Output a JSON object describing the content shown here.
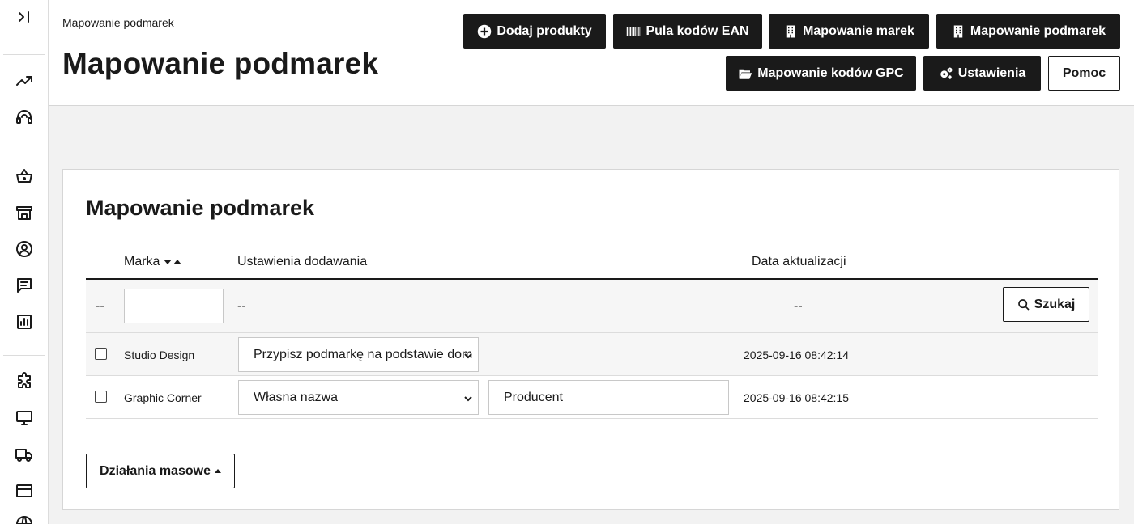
{
  "header": {
    "breadcrumb": "Mapowanie podmarek",
    "title": "Mapowanie podmarek"
  },
  "toolbar": {
    "add_products": "Dodaj produkty",
    "ean_pool": "Pula kodów EAN",
    "brand_mapping": "Mapowanie marek",
    "subbrand_mapping": "Mapowanie podmarek",
    "gpc_mapping": "Mapowanie kodów GPC",
    "settings": "Ustawienia",
    "help": "Pomoc"
  },
  "sidebar": {
    "icons": [
      "expand-sidebar-icon",
      "trending-icon",
      "headset-icon",
      "basket-icon",
      "store-icon",
      "user-icon",
      "chat-icon",
      "chart-icon",
      "puzzle-icon",
      "monitor-icon",
      "truck-icon",
      "credit-card-icon",
      "globe-icon"
    ]
  },
  "card": {
    "title": "Mapowanie podmarek",
    "columns": {
      "brand": "Marka",
      "add_settings": "Ustawienia dodawania",
      "updated": "Data aktualizacji"
    },
    "filters": {
      "checkbox_placeholder": "--",
      "brand_value": "",
      "add_settings_placeholder": "--",
      "updated_placeholder": "--",
      "search_label": "Szukaj"
    },
    "rows": [
      {
        "brand": "Studio Design",
        "setting": "Przypisz podmarkę na podstawie dom",
        "custom_name": "",
        "updated": "2025-09-16 08:42:14"
      },
      {
        "brand": "Graphic Corner",
        "setting": "Własna nazwa",
        "custom_name": "Producent",
        "updated": "2025-09-16 08:42:15"
      }
    ],
    "bulk_actions": "Działania masowe"
  }
}
